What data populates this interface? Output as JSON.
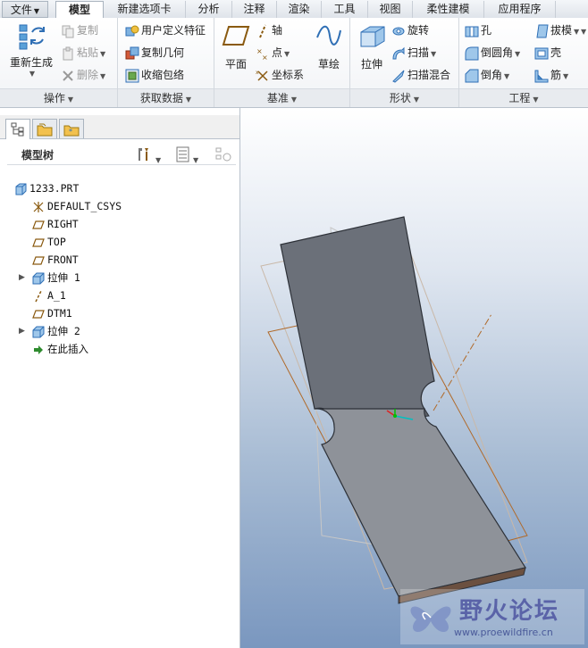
{
  "tabs": [
    {
      "label": "文件",
      "has_dropdown": true
    },
    {
      "label": "模型",
      "active": true
    },
    {
      "label": "新建选项卡"
    },
    {
      "label": "分析"
    },
    {
      "label": "注释"
    },
    {
      "label": "渲染"
    },
    {
      "label": "工具"
    },
    {
      "label": "视图"
    },
    {
      "label": "柔性建模"
    },
    {
      "label": "应用程序"
    }
  ],
  "ribbon": {
    "operations": {
      "group_label": "操作",
      "regenerate": "重新生成",
      "copy": "复制",
      "paste": "粘贴",
      "delete": "删除"
    },
    "get_data": {
      "group_label": "获取数据",
      "udf": "用户定义特征",
      "copy_geom": "复制几何",
      "shrinkwrap": "收缩包络"
    },
    "datum": {
      "group_label": "基准",
      "plane": "平面",
      "axis": "轴",
      "point": "点",
      "csys": "坐标系",
      "sketch": "草绘"
    },
    "shapes": {
      "group_label": "形状",
      "extrude": "拉伸",
      "revolve": "旋转",
      "sweep": "扫描",
      "swept_blend": "扫描混合"
    },
    "engineering": {
      "group_label": "工程",
      "hole": "孔",
      "round": "倒圆角",
      "chamfer": "倒角",
      "draft": "拔模",
      "shell": "壳",
      "rib": "筋"
    }
  },
  "model_tree": {
    "title": "模型树",
    "items": [
      {
        "label": "1233.PRT",
        "icon": "part-icon",
        "level": 0
      },
      {
        "label": "DEFAULT_CSYS",
        "icon": "csys-icon",
        "level": 1
      },
      {
        "label": "RIGHT",
        "icon": "datum-plane-icon",
        "level": 1
      },
      {
        "label": "TOP",
        "icon": "datum-plane-icon",
        "level": 1
      },
      {
        "label": "FRONT",
        "icon": "datum-plane-icon",
        "level": 1
      },
      {
        "label": "拉伸 1",
        "icon": "extrude-icon",
        "level": 1,
        "expandable": true
      },
      {
        "label": "A_1",
        "icon": "axis-icon",
        "level": 1
      },
      {
        "label": "DTM1",
        "icon": "datum-plane-icon",
        "level": 1
      },
      {
        "label": "拉伸 2",
        "icon": "extrude-icon",
        "level": 1,
        "expandable": true
      },
      {
        "label": "在此插入",
        "icon": "insert-arrow-icon",
        "level": 1
      }
    ]
  },
  "watermark": {
    "title": "野火论坛",
    "url": "www.proewildfire.cn"
  },
  "colors": {
    "accent": "#2f6fb5",
    "plane_color": "#b06a2a",
    "model_color": "#8a8f96"
  }
}
